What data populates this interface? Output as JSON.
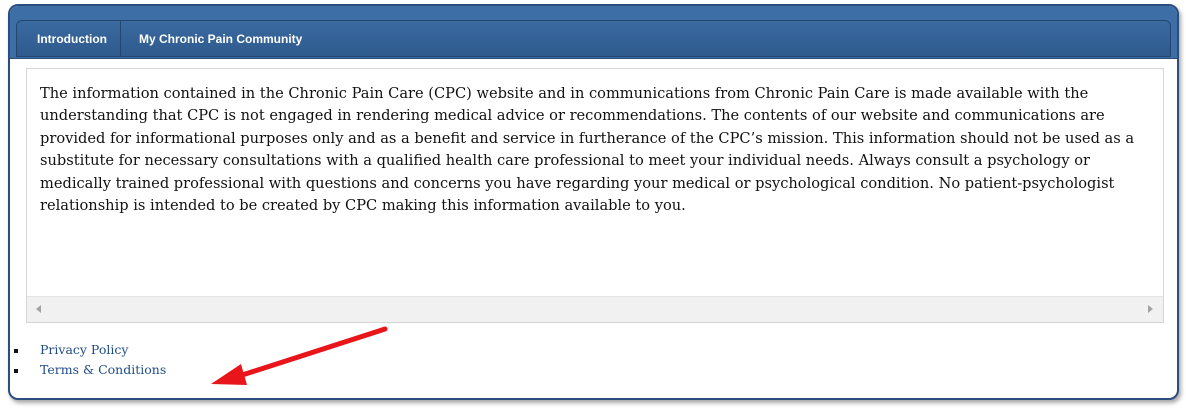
{
  "tabs": [
    {
      "label": "Introduction"
    },
    {
      "label": "My Chronic Pain Community"
    }
  ],
  "content": {
    "text": "The information contained in the Chronic Pain Care (CPC) website and in communications from Chronic Pain Care is made available with the understanding that CPC is not engaged in rendering medical advice or recommendations. The contents of our website and communications are provided for informational purposes only and as a benefit and service in furtherance of the CPC’s mission. This information should not be used as a substitute for necessary consultations with a qualified health care professional to meet your individual needs.  Always consult a psychology or medically trained professional with questions and concerns you have regarding your medical or psychological condition. No patient-psychologist relationship is intended to be created by CPC making this information available to you."
  },
  "links": [
    {
      "label": "Privacy Policy"
    },
    {
      "label": "Terms & Conditions"
    }
  ],
  "colors": {
    "tab_bar": "#3d6fa6",
    "link": "#1f4c86",
    "annotation_arrow": "#e8151b"
  },
  "icons": {
    "scroll_left": "triangle-left-icon",
    "scroll_right": "triangle-right-icon",
    "annotation": "red-arrow-icon"
  }
}
